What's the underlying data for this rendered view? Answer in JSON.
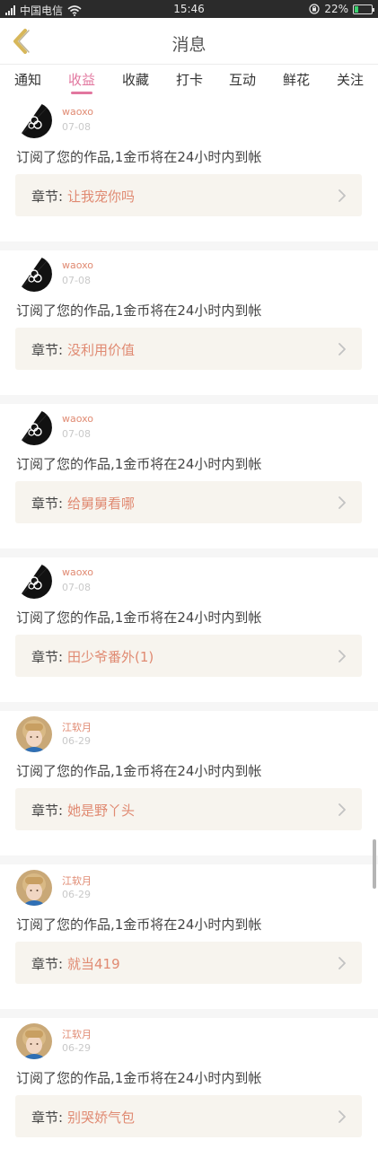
{
  "status_bar": {
    "carrier": "中国电信",
    "time": "15:46",
    "battery": "22%",
    "battery_level": 0.22,
    "battery_color": "#3bd16f"
  },
  "header": {
    "title": "消息",
    "back_icon": "chevron-left-icon",
    "accent_color": "#d7b75a"
  },
  "tabs": {
    "items": [
      "通知",
      "收益",
      "收藏",
      "打卡",
      "互动",
      "鲜花",
      "关注"
    ],
    "active": "收益",
    "active_color": "#e2779f"
  },
  "messages": [
    {
      "name": "waoxo",
      "date": "07-08",
      "text": "订阅了您的作品,1金币将在24小时内到帐",
      "chapter_label": "章节:",
      "chapter": "让我宠你吗",
      "avatar": "black-fan-avatar"
    },
    {
      "name": "waoxo",
      "date": "07-08",
      "text": "订阅了您的作品,1金币将在24小时内到帐",
      "chapter_label": "章节:",
      "chapter": "没利用价值",
      "avatar": "black-fan-avatar"
    },
    {
      "name": "waoxo",
      "date": "07-08",
      "text": "订阅了您的作品,1金币将在24小时内到帐",
      "chapter_label": "章节:",
      "chapter": "给舅舅看哪",
      "avatar": "black-fan-avatar"
    },
    {
      "name": "waoxo",
      "date": "07-08",
      "text": "订阅了您的作品,1金币将在24小时内到帐",
      "chapter_label": "章节:",
      "chapter": "田少爷番外(1)",
      "avatar": "black-fan-avatar"
    },
    {
      "name": "江软月",
      "date": "06-29",
      "text": "订阅了您的作品,1金币将在24小时内到帐",
      "chapter_label": "章节:",
      "chapter": "她是野丫头",
      "avatar": "photo-avatar"
    },
    {
      "name": "江软月",
      "date": "06-29",
      "text": "订阅了您的作品,1金币将在24小时内到帐",
      "chapter_label": "章节:",
      "chapter": "就当419",
      "avatar": "photo-avatar"
    },
    {
      "name": "江软月",
      "date": "06-29",
      "text": "订阅了您的作品,1金币将在24小时内到帐",
      "chapter_label": "章节:",
      "chapter": "别哭娇气包",
      "avatar": "photo-avatar"
    }
  ],
  "colors": {
    "name": "#e08a72",
    "date": "#c9c9c9",
    "chapter_bg": "#f7f4ee"
  }
}
